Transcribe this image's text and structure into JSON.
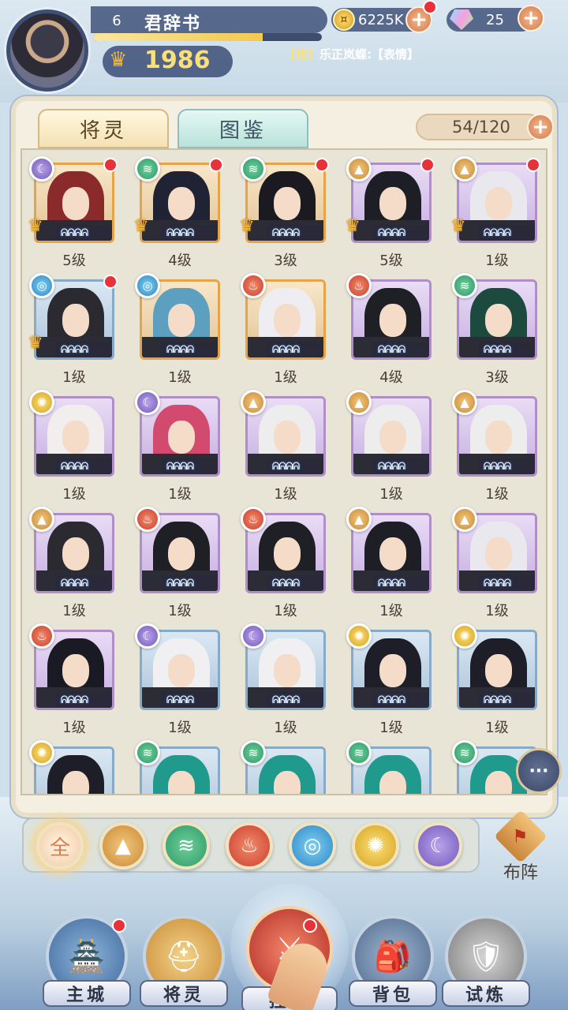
{
  "header": {
    "player_level": "6",
    "player_name": "君辞书",
    "power": "1986",
    "gold": "6225K",
    "gems": "25",
    "chat_channel": "【世】",
    "chat_text": "乐正岚蝶:【表情】"
  },
  "tabs": [
    {
      "label": "将灵"
    },
    {
      "label": "图鉴"
    }
  ],
  "capacity": "54/120",
  "heroes": [
    {
      "level": "5级",
      "element": "dark",
      "border": "orange",
      "hair": "#8a2a2a",
      "red_dot": true,
      "crown": true
    },
    {
      "level": "4级",
      "element": "wind",
      "border": "orange",
      "hair": "#1f2333",
      "red_dot": true,
      "crown": true
    },
    {
      "level": "3级",
      "element": "wind",
      "border": "orange",
      "hair": "#1a1a20",
      "red_dot": true,
      "crown": true
    },
    {
      "level": "5级",
      "element": "earth",
      "border": "purple",
      "hair": "#1e1f26",
      "red_dot": true,
      "crown": true
    },
    {
      "level": "1级",
      "element": "earth",
      "border": "purple",
      "hair": "#e8e8ee",
      "red_dot": true,
      "crown": true
    },
    {
      "level": "1级",
      "element": "water",
      "border": "blue",
      "hair": "#2a2a30",
      "red_dot": true,
      "crown": true
    },
    {
      "level": "1级",
      "element": "water",
      "border": "orange",
      "hair": "#5d9fbf",
      "red_dot": false,
      "crown": false
    },
    {
      "level": "1级",
      "element": "fire",
      "border": "orange",
      "hair": "#eeeef2",
      "red_dot": false,
      "crown": false
    },
    {
      "level": "4级",
      "element": "fire",
      "border": "purple",
      "hair": "#1f1f26",
      "red_dot": false,
      "crown": false
    },
    {
      "level": "3级",
      "element": "wind",
      "border": "purple",
      "hair": "#1d4a3e",
      "red_dot": false,
      "crown": false
    },
    {
      "level": "1级",
      "element": "light",
      "border": "purple",
      "hair": "#f2eeee",
      "red_dot": false,
      "crown": false
    },
    {
      "level": "1级",
      "element": "dark",
      "border": "purple",
      "hair": "#d24a6e",
      "red_dot": false,
      "crown": false
    },
    {
      "level": "1级",
      "element": "earth",
      "border": "purple",
      "hair": "#ededee",
      "red_dot": false,
      "crown": false
    },
    {
      "level": "1级",
      "element": "earth",
      "border": "purple",
      "hair": "#ededee",
      "red_dot": false,
      "crown": false
    },
    {
      "level": "1级",
      "element": "earth",
      "border": "purple",
      "hair": "#ededee",
      "red_dot": false,
      "crown": false
    },
    {
      "level": "1级",
      "element": "earth",
      "border": "purple",
      "hair": "#2a2a30",
      "red_dot": false,
      "crown": false
    },
    {
      "level": "1级",
      "element": "fire",
      "border": "purple",
      "hair": "#1f1f26",
      "red_dot": false,
      "crown": false
    },
    {
      "level": "1级",
      "element": "fire",
      "border": "purple",
      "hair": "#1f1f26",
      "red_dot": false,
      "crown": false
    },
    {
      "level": "1级",
      "element": "earth",
      "border": "purple",
      "hair": "#1e1f26",
      "red_dot": false,
      "crown": false
    },
    {
      "level": "1级",
      "element": "earth",
      "border": "purple",
      "hair": "#e8e8ee",
      "red_dot": false,
      "crown": false
    },
    {
      "level": "1级",
      "element": "fire",
      "border": "purple",
      "hair": "#1a1a24",
      "red_dot": false,
      "crown": false
    },
    {
      "level": "1级",
      "element": "dark",
      "border": "blue",
      "hair": "#f0f0f2",
      "red_dot": false,
      "crown": false
    },
    {
      "level": "1级",
      "element": "dark",
      "border": "blue",
      "hair": "#f0f0f2",
      "red_dot": false,
      "crown": false
    },
    {
      "level": "1级",
      "element": "light",
      "border": "blue",
      "hair": "#1e1e28",
      "red_dot": false,
      "crown": false
    },
    {
      "level": "1级",
      "element": "light",
      "border": "blue",
      "hair": "#1e1e28",
      "red_dot": false,
      "crown": false
    },
    {
      "level": "",
      "element": "light",
      "border": "blue",
      "hair": "#1e1e28",
      "red_dot": false,
      "crown": false
    },
    {
      "level": "",
      "element": "wind",
      "border": "blue",
      "hair": "#1f9a8c",
      "red_dot": false,
      "crown": false
    },
    {
      "level": "",
      "element": "wind",
      "border": "blue",
      "hair": "#1f9a8c",
      "red_dot": false,
      "crown": false
    },
    {
      "level": "",
      "element": "wind",
      "border": "blue",
      "hair": "#1f9a8c",
      "red_dot": false,
      "crown": false
    },
    {
      "level": "",
      "element": "wind",
      "border": "blue",
      "hair": "#1f9a8c",
      "red_dot": false,
      "crown": false
    }
  ],
  "filters": [
    {
      "key": "all",
      "label": "全"
    },
    {
      "key": "earth",
      "icon": "mountain-icon"
    },
    {
      "key": "wind",
      "icon": "whirlwind-icon"
    },
    {
      "key": "fire",
      "icon": "flame-icon"
    },
    {
      "key": "water",
      "icon": "wave-icon"
    },
    {
      "key": "light",
      "icon": "sun-icon"
    },
    {
      "key": "dark",
      "icon": "moon-icon"
    }
  ],
  "formation_label": "布阵",
  "nav": [
    {
      "label": "主城",
      "icon": "castle-icon",
      "red_dot": true
    },
    {
      "label": "将灵",
      "icon": "helmet-icon",
      "red_dot": false
    },
    {
      "label": "挂机",
      "icon": "swords-icon",
      "red_dot": true
    },
    {
      "label": "背包",
      "icon": "bag-icon",
      "red_dot": false
    },
    {
      "label": "试炼",
      "icon": "shield-icon",
      "red_dot": false
    }
  ],
  "element_colors": {
    "wind": "#2f9a68",
    "fire": "#cc3f2f",
    "water": "#2c87c7",
    "earth": "#c98a33",
    "light": "#d7a21e",
    "dark": "#7358bc"
  },
  "element_glyphs": {
    "wind": "≋",
    "fire": "♨",
    "water": "◎",
    "earth": "▲",
    "light": "✺",
    "dark": "☾"
  },
  "rarity_glyph": "ᕱᕱᕱᕱ"
}
